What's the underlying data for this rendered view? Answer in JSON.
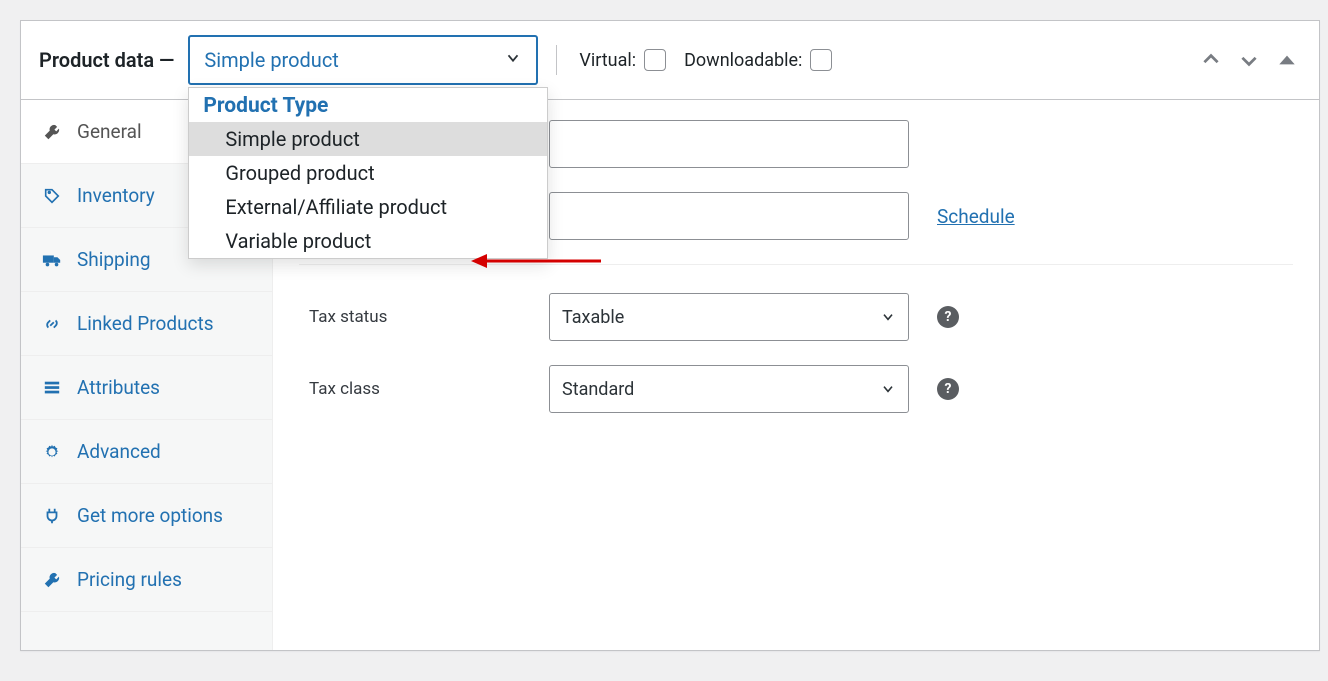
{
  "panel": {
    "title": "Product data —"
  },
  "product_type_select": {
    "value": "Simple product",
    "group_label": "Product Type",
    "options": [
      "Simple product",
      "Grouped product",
      "External/Affiliate product",
      "Variable product"
    ],
    "selected_index": 0
  },
  "checkboxes": {
    "virtual_label": "Virtual:",
    "virtual_checked": false,
    "downloadable_label": "Downloadable:",
    "downloadable_checked": false
  },
  "sidebar": {
    "tabs": [
      {
        "label": "General",
        "icon": "wrench",
        "active": true
      },
      {
        "label": "Inventory",
        "icon": "tag",
        "active": false
      },
      {
        "label": "Shipping",
        "icon": "truck",
        "active": false
      },
      {
        "label": "Linked Products",
        "icon": "link",
        "active": false
      },
      {
        "label": "Attributes",
        "icon": "list",
        "active": false
      },
      {
        "label": "Advanced",
        "icon": "gear",
        "active": false
      },
      {
        "label": "Get more options",
        "icon": "plug",
        "active": false
      },
      {
        "label": "Pricing rules",
        "icon": "wrench",
        "active": false
      }
    ]
  },
  "form": {
    "regular_price_value": "",
    "sale_price_value": "",
    "schedule_link": "Schedule",
    "tax_status_label": "Tax status",
    "tax_status_value": "Taxable",
    "tax_class_label": "Tax class",
    "tax_class_value": "Standard"
  }
}
